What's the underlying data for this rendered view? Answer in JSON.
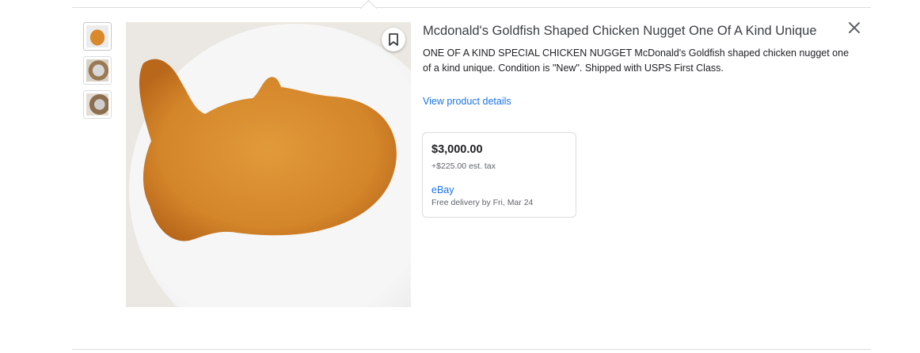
{
  "product": {
    "title": "Mcdonald's Goldfish Shaped Chicken Nugget One Of A Kind Unique",
    "description": "ONE OF A KIND SPECIAL CHICKEN NUGGET McDonald's Goldfish shaped chicken nugget one of a kind unique. Condition is \"New\". Shipped with USPS First Class.",
    "details_link": "View product details"
  },
  "offer": {
    "price": "$3,000.00",
    "tax": "+$225.00 est. tax",
    "seller": "eBay",
    "delivery": "Free delivery by Fri, Mar 24"
  },
  "icons": {
    "save": "bookmark-icon",
    "close": "close-icon"
  },
  "colors": {
    "link": "#1a73e8",
    "nugget": "#d9892c",
    "plate": "#f4f4f4"
  }
}
